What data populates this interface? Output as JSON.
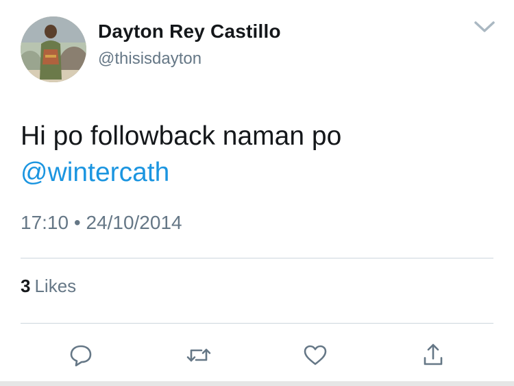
{
  "tweet": {
    "author_name": "Dayton Rey Castillo",
    "author_handle": "@thisisdayton",
    "text": "Hi po followback naman po",
    "mention": "@wintercath",
    "time": "17:10",
    "separator": "•",
    "date": "24/10/2014"
  },
  "stats": {
    "likes_count": "3",
    "likes_label": "Likes"
  },
  "icons": {
    "menu": "chevron-down-icon",
    "reply": "reply-icon",
    "retweet": "retweet-icon",
    "like": "heart-icon",
    "share": "share-icon"
  },
  "colors": {
    "text": "#14171a",
    "secondary": "#657786",
    "link": "#1b95e0",
    "divider": "#ccd6dd"
  }
}
